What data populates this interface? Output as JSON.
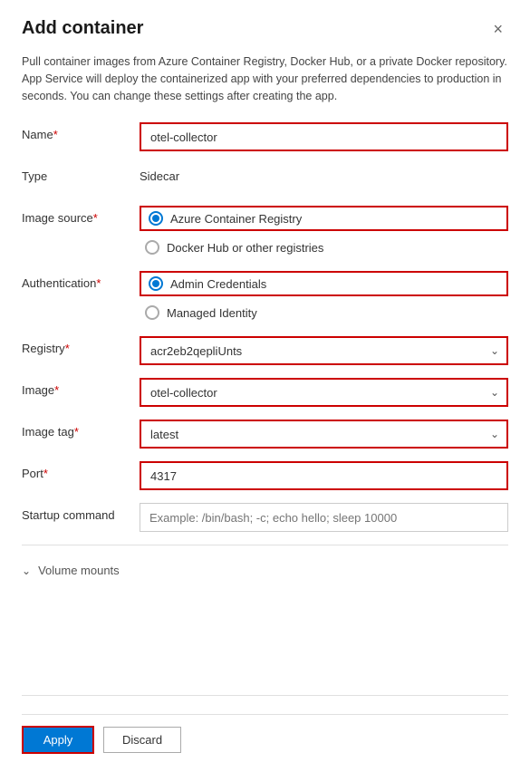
{
  "dialog": {
    "title": "Add container",
    "close_label": "×",
    "description": "Pull container images from Azure Container Registry, Docker Hub, or a private Docker repository. App Service will deploy the containerized app with your preferred dependencies to production in seconds. You can change these settings after creating the app."
  },
  "form": {
    "name_label": "Name",
    "name_required": "*",
    "name_value": "otel-collector",
    "type_label": "Type",
    "type_value": "Sidecar",
    "image_source_label": "Image source",
    "image_source_required": "*",
    "image_source_option1": "Azure Container Registry",
    "image_source_option2": "Docker Hub or other registries",
    "authentication_label": "Authentication",
    "authentication_required": "*",
    "authentication_option1": "Admin Credentials",
    "authentication_option2": "Managed Identity",
    "registry_label": "Registry",
    "registry_required": "*",
    "registry_value": "acr2eb2qepliUnts",
    "image_label": "Image",
    "image_required": "*",
    "image_value": "otel-collector",
    "image_tag_label": "Image tag",
    "image_tag_required": "*",
    "image_tag_value": "latest",
    "port_label": "Port",
    "port_required": "*",
    "port_value": "4317",
    "startup_label": "Startup command",
    "startup_placeholder": "Example: /bin/bash; -c; echo hello; sleep 10000",
    "volume_mounts_label": "Volume mounts",
    "apply_label": "Apply",
    "discard_label": "Discard"
  }
}
